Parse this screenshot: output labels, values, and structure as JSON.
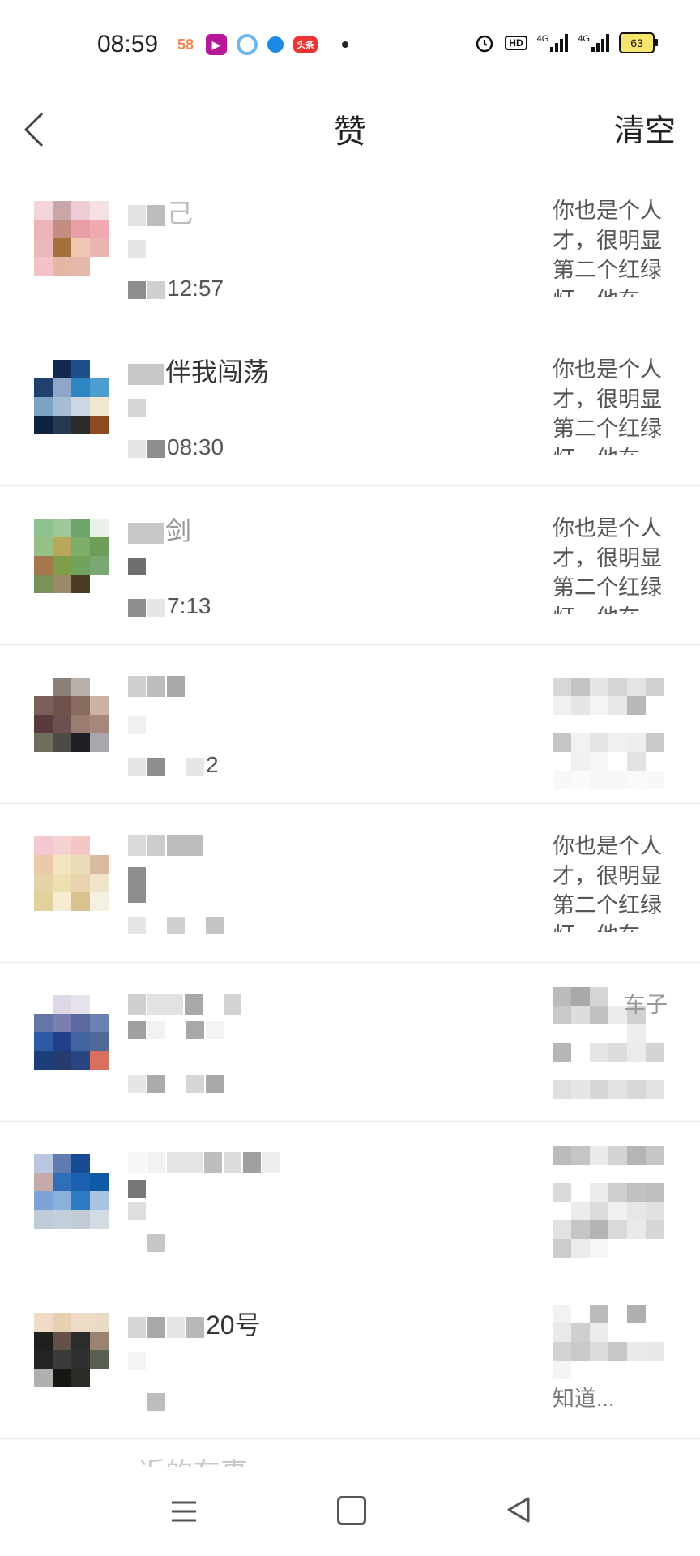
{
  "status_bar": {
    "time": "08:59",
    "app_icons": [
      "58",
      "video-app",
      "browser",
      "dot-app",
      "头条"
    ],
    "network_1": "4G",
    "network_2": "4G",
    "hd": "HD",
    "battery": "63"
  },
  "header": {
    "title": "赞",
    "clear_label": "清空"
  },
  "rows": [
    {
      "name": "己",
      "time": "12:57",
      "comment": "你也是个人才，很明显第二个红绿灯，他在..."
    },
    {
      "name": "伴我闯荡",
      "time": "08:30",
      "comment": "你也是个人才，很明显第二个红绿灯，他在..."
    },
    {
      "name": "剑",
      "time": "7:13",
      "comment": "你也是个人才，很明显第二个红绿灯，他在..."
    },
    {
      "name": "",
      "time": "2",
      "comment": ""
    },
    {
      "name": "",
      "time": "",
      "comment": "你也是个人才，很明显第二个红绿灯，他在..."
    },
    {
      "name": "",
      "time": "",
      "comment": "车子"
    },
    {
      "name": "",
      "time": "",
      "comment": ""
    },
    {
      "name": "20号",
      "time": "",
      "comment": "知道..."
    }
  ],
  "bottom_cut_text": "近的车事",
  "colors": {
    "divider": "#ececec",
    "text_primary": "#222222",
    "text_secondary": "#555555"
  }
}
